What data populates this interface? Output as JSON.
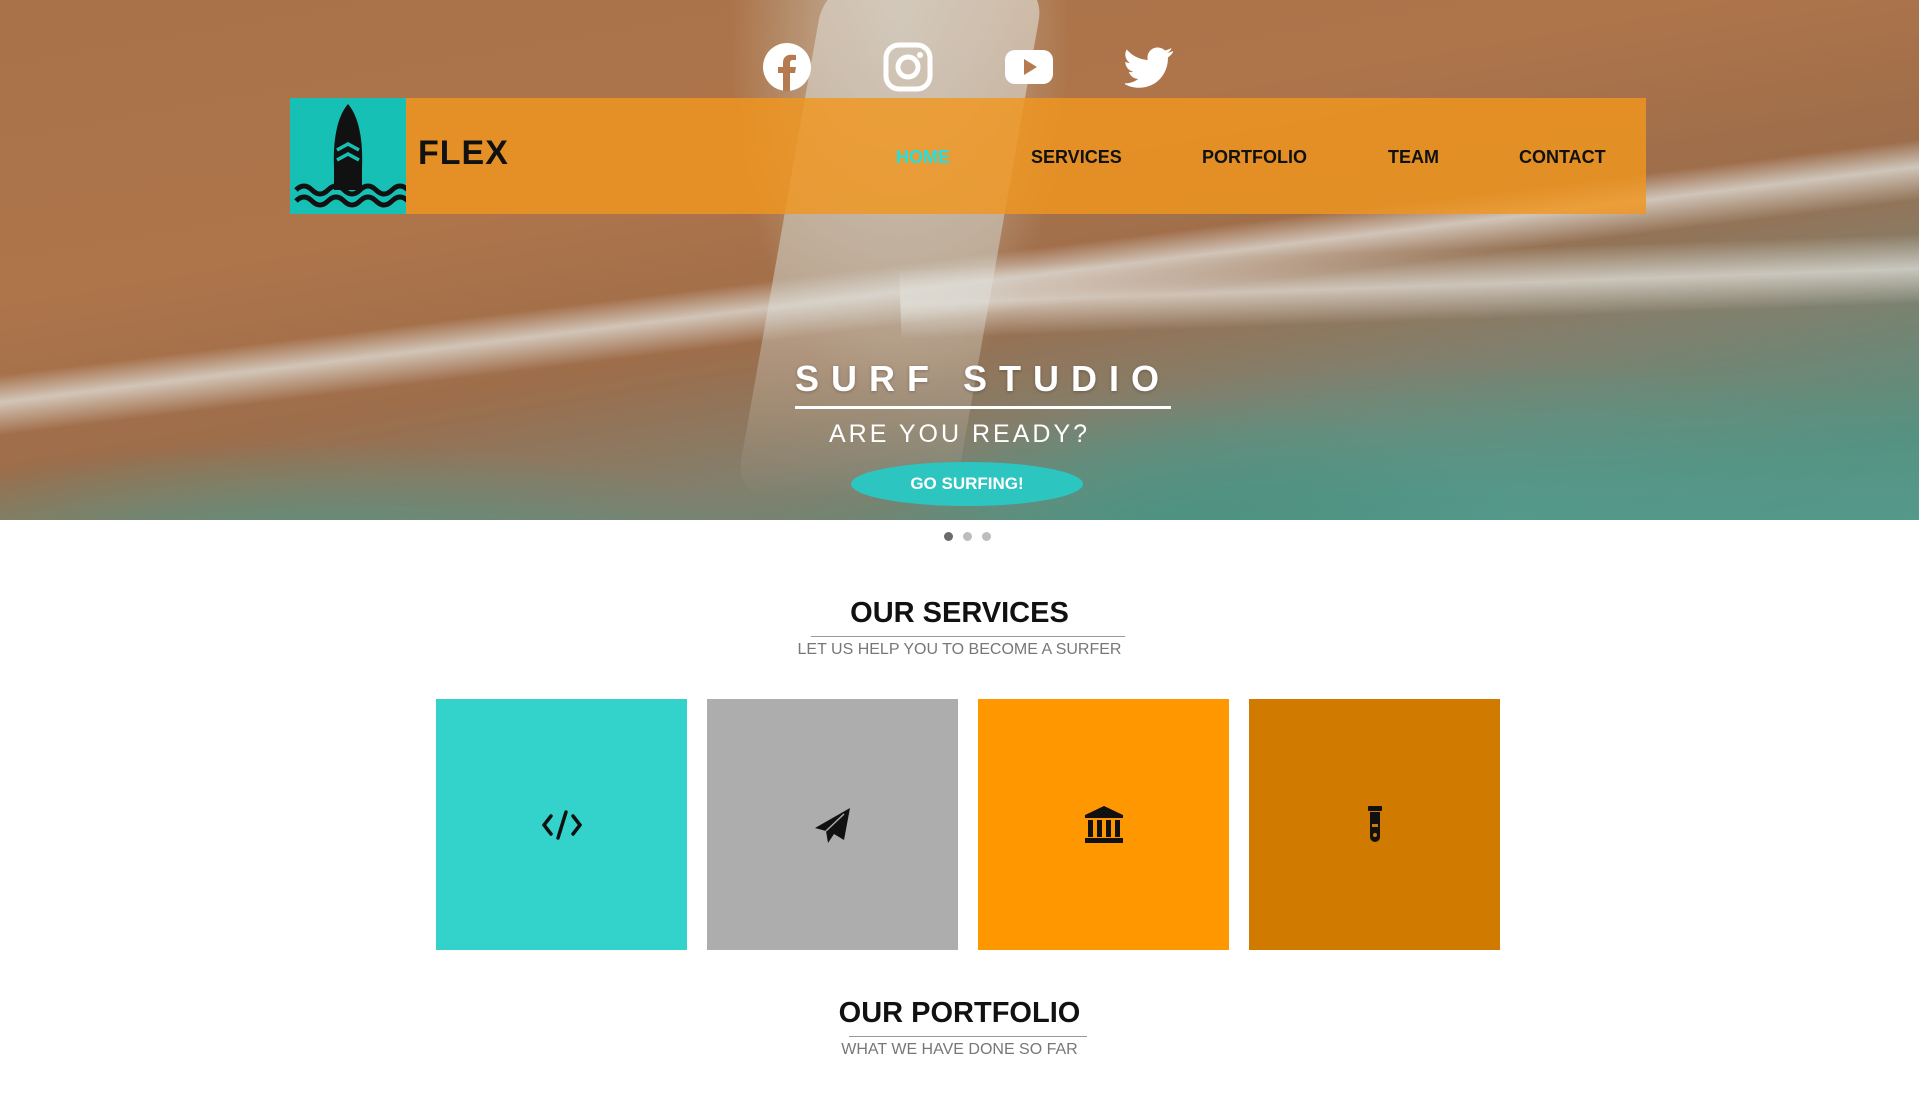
{
  "header": {
    "social": [
      {
        "icon": "facebook-icon"
      },
      {
        "icon": "instagram-icon"
      },
      {
        "icon": "youtube-icon"
      },
      {
        "icon": "twitter-icon"
      }
    ],
    "brand": "FLEX",
    "nav": [
      {
        "label": "HOME",
        "active": true
      },
      {
        "label": "SERVICES",
        "active": false
      },
      {
        "label": "PORTFOLIO",
        "active": false
      },
      {
        "label": "TEAM",
        "active": false
      },
      {
        "label": "CONTACT",
        "active": false
      }
    ]
  },
  "hero": {
    "title": "SURF STUDIO",
    "subtitle": "ARE  YOU  READY?",
    "cta": "GO SURFING!",
    "slides": 3,
    "active_slide": 1
  },
  "services": {
    "title": "OUR SERVICES",
    "subtitle": "LET US HELP YOU TO BECOME A SURFER",
    "cards": [
      {
        "icon": "code-icon",
        "color": "#33d3cc"
      },
      {
        "icon": "paper-plane-icon",
        "color": "#adadad"
      },
      {
        "icon": "bank-icon",
        "color": "#fe9700"
      },
      {
        "icon": "flask-icon",
        "color": "#d07b00"
      }
    ]
  },
  "portfolio": {
    "title": "OUR PORTFOLIO",
    "subtitle": "WHAT WE HAVE DONE SO FAR"
  },
  "colors": {
    "accent": "#2cc5bf",
    "nav_bar": "#f0961e",
    "active_nav": "#22e0e0"
  }
}
